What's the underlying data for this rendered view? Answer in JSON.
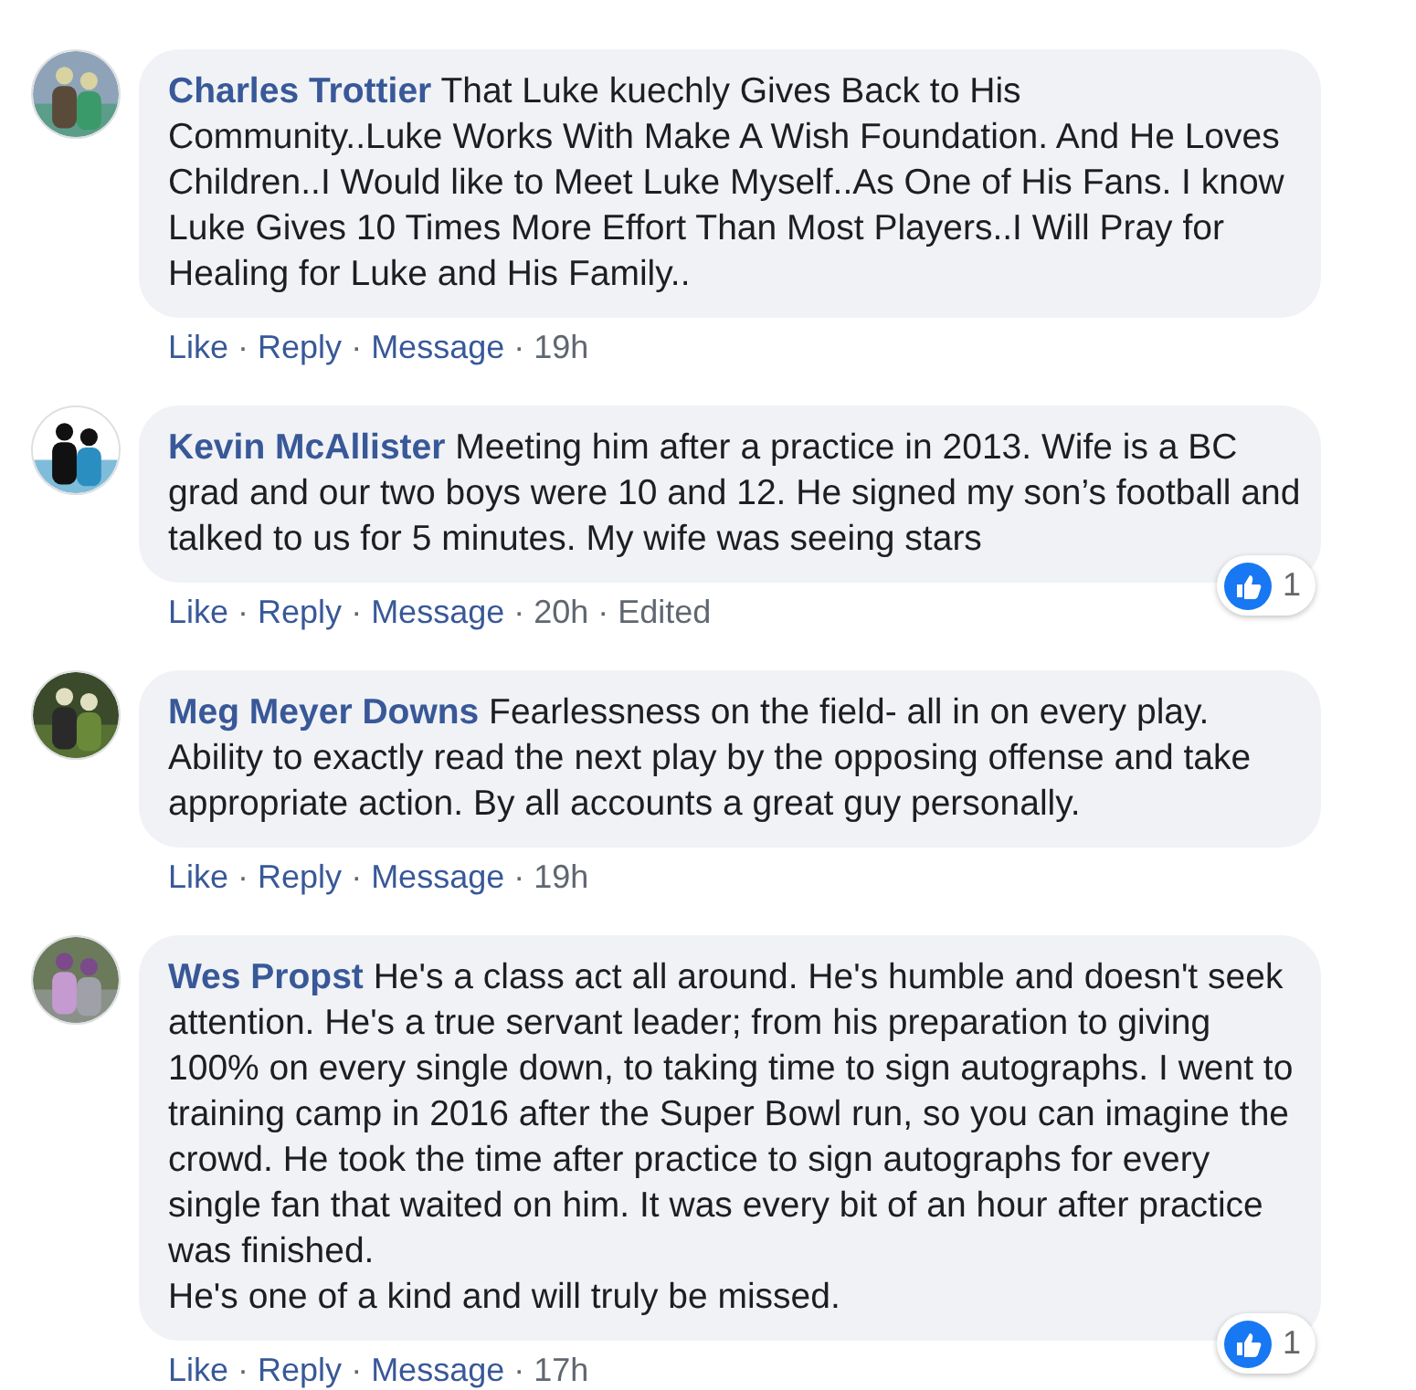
{
  "separator": "·",
  "comments": [
    {
      "avatar": {
        "kind": "picture"
      },
      "name": "Charles Trottier",
      "text": "That Luke kuechly Gives Back to His Community..Luke Works With Make A Wish Foundation. And He Loves Children..I Would like to Meet Luke Myself..As One of His Fans. I know Luke Gives 10 Times More Effort Than Most Players..I Will Pray for Healing for Luke and His Family..",
      "actions": [
        "Like",
        "Reply",
        "Message"
      ],
      "time": "19h"
    },
    {
      "avatar": {
        "kind": "picture"
      },
      "name": "Kevin McAllister",
      "text": "Meeting him after a practice in 2013. Wife is a BC grad and our two boys were 10 and 12. He signed my son’s football and talked to us for 5 minutes. My wife was seeing stars",
      "actions": [
        "Like",
        "Reply",
        "Message"
      ],
      "time": "20h",
      "edited": "Edited",
      "reaction_count": "1"
    },
    {
      "avatar": {
        "kind": "picture"
      },
      "name": "Meg Meyer Downs",
      "text": "Fearlessness on the field- all in on every play. Ability to exactly read the next play by the opposing offense and take appropriate action. By all accounts a great guy personally.",
      "actions": [
        "Like",
        "Reply",
        "Message"
      ],
      "time": "19h"
    },
    {
      "avatar": {
        "kind": "picture"
      },
      "name": "Wes Propst",
      "text": "He's a class act all around. He's humble and doesn't seek attention. He's a true servant leader; from his preparation to giving 100% on every single down, to taking time to sign autographs. I went to training camp in 2016 after the Super Bowl run, so you can imagine the crowd. He took the time after practice to sign autographs for every single fan that waited on him. It was every bit of an hour after practice was finished.\nHe's one of a kind and will truly be missed.",
      "actions": [
        "Like",
        "Reply",
        "Message"
      ],
      "time": "17h",
      "reaction_count": "1"
    }
  ]
}
